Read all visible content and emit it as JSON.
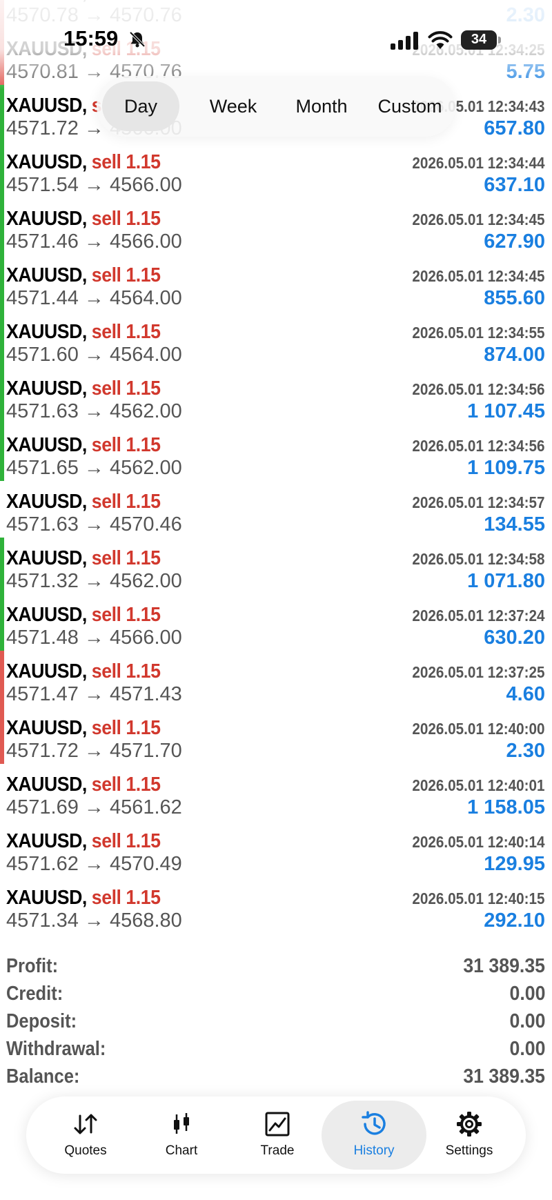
{
  "status_bar": {
    "time": "15:59",
    "battery": "34"
  },
  "period_tabs": [
    {
      "label": "Day",
      "active": true
    },
    {
      "label": "Week",
      "active": false
    },
    {
      "label": "Month",
      "active": false
    },
    {
      "label": "Custom",
      "active": false
    }
  ],
  "deals": [
    {
      "symbol": "XAUUSD,",
      "side": "sell 1.15",
      "time": "2026.05.01 12:34:24",
      "open": "4570.78",
      "close": "4570.76",
      "profit": "2.30",
      "marker": "red"
    },
    {
      "symbol": "XAUUSD,",
      "side": "sell 1.15",
      "time": "2026.05.01 12:34:25",
      "open": "4570.81",
      "close": "4570.76",
      "profit": "5.75",
      "marker": "red"
    },
    {
      "symbol": "XAUUSD,",
      "side": "sell 1.15",
      "time": "2026.05.01 12:34:43",
      "open": "4571.72",
      "close": "4566.00",
      "profit": "657.80",
      "marker": "green"
    },
    {
      "symbol": "XAUUSD,",
      "side": "sell 1.15",
      "time": "2026.05.01 12:34:44",
      "open": "4571.54",
      "close": "4566.00",
      "profit": "637.10",
      "marker": "green"
    },
    {
      "symbol": "XAUUSD,",
      "side": "sell 1.15",
      "time": "2026.05.01 12:34:45",
      "open": "4571.46",
      "close": "4566.00",
      "profit": "627.90",
      "marker": "green"
    },
    {
      "symbol": "XAUUSD,",
      "side": "sell 1.15",
      "time": "2026.05.01 12:34:45",
      "open": "4571.44",
      "close": "4564.00",
      "profit": "855.60",
      "marker": "green"
    },
    {
      "symbol": "XAUUSD,",
      "side": "sell 1.15",
      "time": "2026.05.01 12:34:55",
      "open": "4571.60",
      "close": "4564.00",
      "profit": "874.00",
      "marker": "green"
    },
    {
      "symbol": "XAUUSD,",
      "side": "sell 1.15",
      "time": "2026.05.01 12:34:56",
      "open": "4571.63",
      "close": "4562.00",
      "profit": "1 107.45",
      "marker": "green"
    },
    {
      "symbol": "XAUUSD,",
      "side": "sell 1.15",
      "time": "2026.05.01 12:34:56",
      "open": "4571.65",
      "close": "4562.00",
      "profit": "1 109.75",
      "marker": "green"
    },
    {
      "symbol": "XAUUSD,",
      "side": "sell 1.15",
      "time": "2026.05.01 12:34:57",
      "open": "4571.63",
      "close": "4570.46",
      "profit": "134.55",
      "marker": "none"
    },
    {
      "symbol": "XAUUSD,",
      "side": "sell 1.15",
      "time": "2026.05.01 12:34:58",
      "open": "4571.32",
      "close": "4562.00",
      "profit": "1 071.80",
      "marker": "green"
    },
    {
      "symbol": "XAUUSD,",
      "side": "sell 1.15",
      "time": "2026.05.01 12:37:24",
      "open": "4571.48",
      "close": "4566.00",
      "profit": "630.20",
      "marker": "green"
    },
    {
      "symbol": "XAUUSD,",
      "side": "sell 1.15",
      "time": "2026.05.01 12:37:25",
      "open": "4571.47",
      "close": "4571.43",
      "profit": "4.60",
      "marker": "red"
    },
    {
      "symbol": "XAUUSD,",
      "side": "sell 1.15",
      "time": "2026.05.01 12:40:00",
      "open": "4571.72",
      "close": "4571.70",
      "profit": "2.30",
      "marker": "red"
    },
    {
      "symbol": "XAUUSD,",
      "side": "sell 1.15",
      "time": "2026.05.01 12:40:01",
      "open": "4571.69",
      "close": "4561.62",
      "profit": "1 158.05",
      "marker": "none"
    },
    {
      "symbol": "XAUUSD,",
      "side": "sell 1.15",
      "time": "2026.05.01 12:40:14",
      "open": "4571.62",
      "close": "4570.49",
      "profit": "129.95",
      "marker": "none"
    },
    {
      "symbol": "XAUUSD,",
      "side": "sell 1.15",
      "time": "2026.05.01 12:40:15",
      "open": "4571.34",
      "close": "4568.80",
      "profit": "292.10",
      "marker": "none"
    }
  ],
  "arrow": "→",
  "summary": [
    {
      "label": "Profit:",
      "value": "31 389.35"
    },
    {
      "label": "Credit:",
      "value": "0.00"
    },
    {
      "label": "Deposit:",
      "value": "0.00"
    },
    {
      "label": "Withdrawal:",
      "value": "0.00"
    },
    {
      "label": "Balance:",
      "value": "31 389.35"
    }
  ],
  "tabs": [
    {
      "label": "Quotes",
      "icon": "quotes-arrows-icon",
      "active": false
    },
    {
      "label": "Chart",
      "icon": "chart-candles-icon",
      "active": false
    },
    {
      "label": "Trade",
      "icon": "trade-chart-icon",
      "active": false
    },
    {
      "label": "History",
      "icon": "history-clock-icon",
      "active": true
    },
    {
      "label": "Settings",
      "icon": "gear-icon",
      "active": false
    }
  ],
  "colors": {
    "marker_green": "#2fb23a",
    "marker_red": "#e05a52",
    "sell": "#d1382d",
    "profit": "#1a7fe0",
    "accent": "#1a7fe0"
  }
}
